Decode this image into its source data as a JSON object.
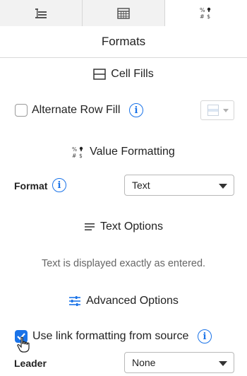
{
  "tabs": [
    {
      "name": "outline-tab",
      "icon": "indent-list-icon"
    },
    {
      "name": "layout-tab",
      "icon": "grid-table-icon"
    },
    {
      "name": "formats-tab",
      "icon": "percent-number-format-icon",
      "active": true
    }
  ],
  "panel": {
    "title": "Formats"
  },
  "cell_fills": {
    "heading": "Cell Fills",
    "alternate_row_fill": {
      "label": "Alternate Row Fill",
      "checked": false
    },
    "fill_color": {
      "icon": "fill-color-swatch-icon"
    }
  },
  "value_formatting": {
    "heading": "Value Formatting",
    "format_label": "Format",
    "format_value": "Text"
  },
  "text_options": {
    "heading": "Text Options",
    "description": "Text is displayed exactly as entered."
  },
  "advanced_options": {
    "heading": "Advanced Options",
    "link_formatting": {
      "label": "Use link formatting from source",
      "checked": true
    },
    "leader_label": "Leader",
    "leader_value": "None"
  },
  "colors": {
    "accent": "#1a73e8",
    "muted_text": "#666666",
    "border": "#d6d6d6"
  }
}
